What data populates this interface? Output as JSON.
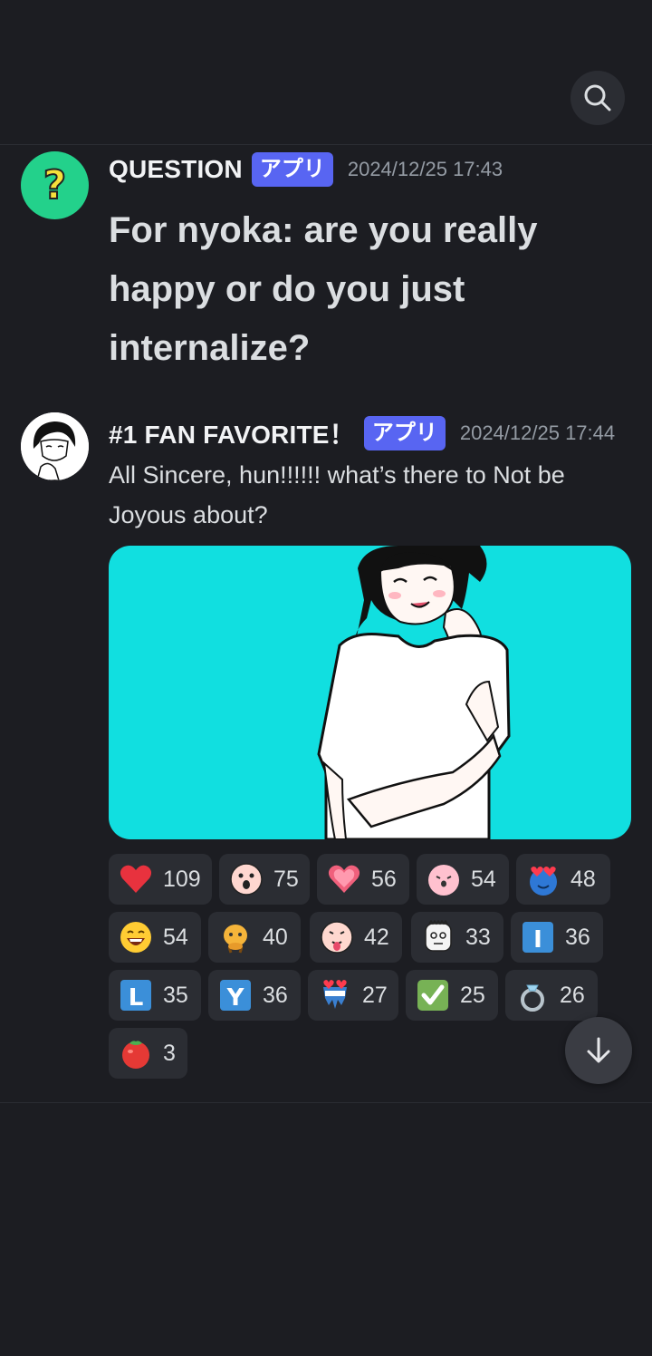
{
  "messages": [
    {
      "author": "QUESTION",
      "badge": "アプリ",
      "timestamp": "2024/12/25 17:43",
      "text": "For nyoka: are you really happy or do you just internalize?",
      "avatar_icon": "question-mark-icon"
    },
    {
      "author": "#1 FAN FAVORITE！",
      "badge": "アプリ",
      "timestamp": "2024/12/25 17:44",
      "text": "All Sincere, hun!!!!!! what’s there to Not be Joyous about?",
      "avatar_icon": "drawn-girl-avatar"
    }
  ],
  "reactions": [
    {
      "icon": "red-heart-icon",
      "count": "109"
    },
    {
      "icon": "shocked-face-icon",
      "count": "75"
    },
    {
      "icon": "sparkling-heart-icon",
      "count": "56"
    },
    {
      "icon": "pink-blob-face-icon",
      "count": "54"
    },
    {
      "icon": "heart-eyes-blue-icon",
      "count": "48"
    },
    {
      "icon": "laughing-face-icon",
      "count": "54"
    },
    {
      "icon": "small-creature-icon",
      "count": "40"
    },
    {
      "icon": "tongue-face-icon",
      "count": "42"
    },
    {
      "icon": "sketch-face-icon",
      "count": "33"
    },
    {
      "icon": "letter-i-icon",
      "count": "36"
    },
    {
      "icon": "letter-l-icon",
      "count": "35"
    },
    {
      "icon": "letter-y-icon",
      "count": "36"
    },
    {
      "icon": "heart-eyes-melting-icon",
      "count": "27"
    },
    {
      "icon": "check-mark-icon",
      "count": "25"
    },
    {
      "icon": "ring-icon",
      "count": "26"
    },
    {
      "icon": "tomato-icon",
      "count": "3"
    }
  ],
  "reaction_letters": {
    "i": "I",
    "l": "L",
    "y": "Y"
  },
  "colors": {
    "background": "#1c1d22",
    "badge": "#5865f2",
    "image_bg": "#11dfe0",
    "question_avatar": "#23d18b"
  }
}
